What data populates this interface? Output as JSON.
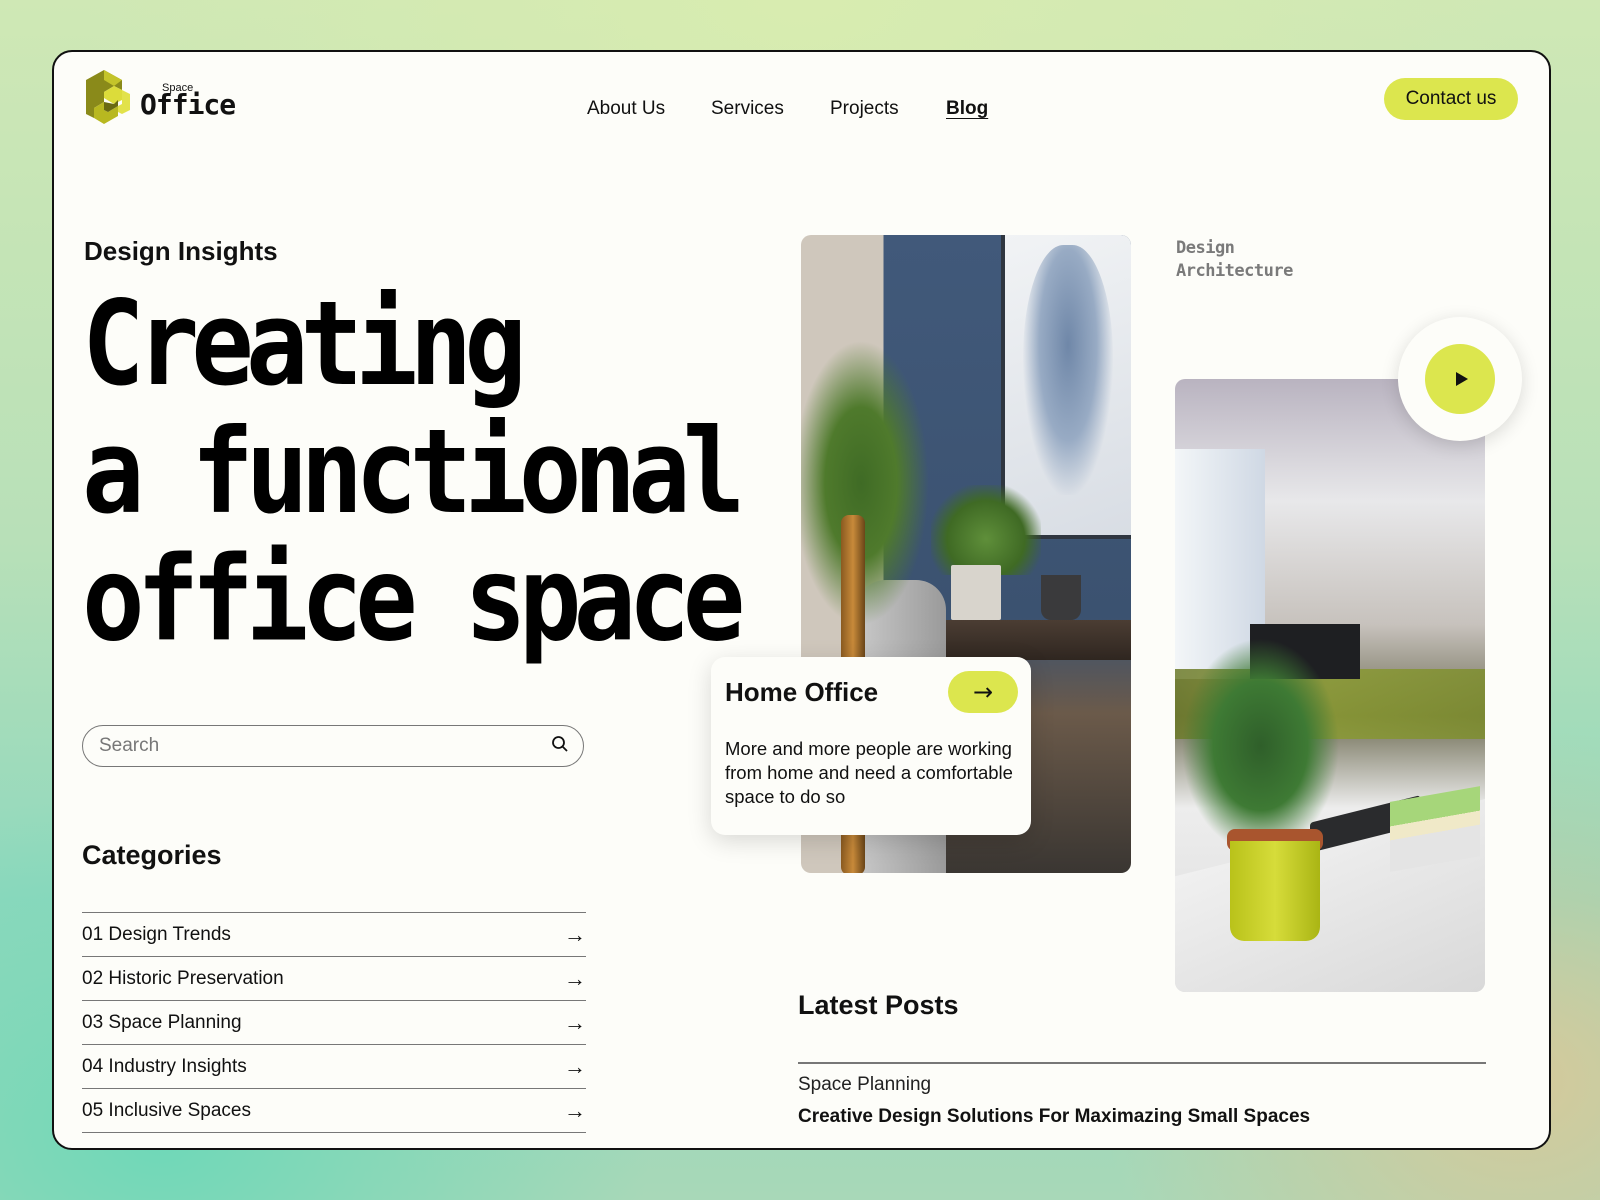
{
  "brand": {
    "name": "Office",
    "superscript": "Space",
    "accent": "#dce64e",
    "logo_color": "#c9c92a"
  },
  "nav": {
    "items": [
      {
        "label": "About Us",
        "active": false
      },
      {
        "label": "Services",
        "active": false
      },
      {
        "label": "Projects",
        "active": false
      },
      {
        "label": "Blog",
        "active": true
      }
    ],
    "contact_label": "Contact us"
  },
  "hero": {
    "eyebrow": "Design Insights",
    "title_lines": [
      "Creating",
      "a functional",
      "office space"
    ]
  },
  "search": {
    "placeholder": "Search",
    "value": "",
    "icon": "search-icon"
  },
  "categories": {
    "title": "Categories",
    "items": [
      {
        "label": "01 Design Trends",
        "icon": "arrow-right-icon"
      },
      {
        "label": "02 Historic Preservation",
        "icon": "arrow-right-icon"
      },
      {
        "label": "03 Space Planning",
        "icon": "arrow-right-icon"
      },
      {
        "label": "04 Industry Insights",
        "icon": "arrow-right-icon"
      },
      {
        "label": "05 Inclusive Spaces",
        "icon": "arrow-right-icon"
      }
    ]
  },
  "feature_card": {
    "title": "Home Office",
    "text": "More and more people are working from home and need a comfortable space to do so",
    "button_icon": "arrow-right-icon"
  },
  "side_label": {
    "line1": "Design",
    "line2": "Architecture"
  },
  "video": {
    "icon": "play-icon"
  },
  "latest_posts": {
    "title": "Latest Posts",
    "items": [
      {
        "category": "Space Planning",
        "title": "Creative Design Solutions For Maximazing Small Spaces"
      }
    ]
  },
  "icons": {
    "arrow": "→"
  }
}
